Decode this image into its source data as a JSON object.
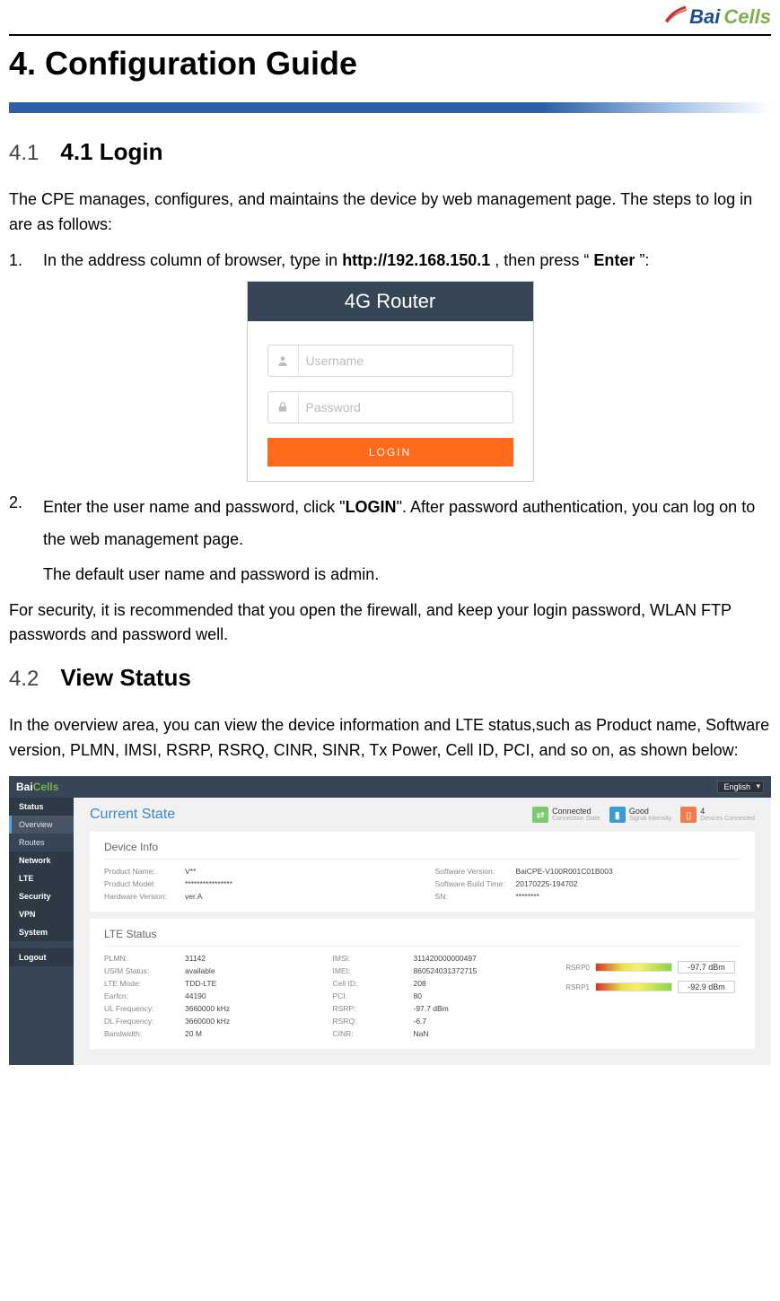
{
  "logo": {
    "part1": "Bai",
    "part2": "Cells"
  },
  "h1": "4. Configuration Guide",
  "sec41": {
    "num": "4.1",
    "title": "4.1 Login",
    "intro": "The CPE manages, configures, and maintains the device by web management page. The steps to log in are as follows:",
    "step1_num": "1.",
    "step1_pre": "In the address column of browser, type in ",
    "step1_bold1": "http://192.168.150.1",
    "step1_mid": ", then press “",
    "step1_bold2": "Enter",
    "step1_post": "”:",
    "step2_num": "2.",
    "step2_pre": "Enter the user name and password, click \"",
    "step2_bold": "LOGIN",
    "step2_post": "\". After password authentication, you can log on to the web management page.",
    "default_creds": "The default user name and password is admin.",
    "security_note": "For security, it is recommended that you open the firewall, and keep your login password, WLAN FTP passwords and password well."
  },
  "login_panel": {
    "banner": "4G Router",
    "username_ph": "Username",
    "password_ph": "Password",
    "login_btn": "LOGIN"
  },
  "sec42": {
    "num": "4.2",
    "title": "View Status",
    "body": "In the overview area, you can view the device information and LTE status,such as Product name, Software version, PLMN, IMSI, RSRP, RSRQ, CINR, SINR, Tx Power, Cell ID, PCI, and so on, as shown below:"
  },
  "shot": {
    "logo_b": "Bai",
    "logo_c": "Cells",
    "lang": "English",
    "side": {
      "status": "Status",
      "overview": "Overview",
      "routes": "Routes",
      "network": "Network",
      "lte": "LTE",
      "security": "Security",
      "vpn": "VPN",
      "system": "System",
      "logout": "Logout"
    },
    "title": "Current State",
    "badges": {
      "b1_top": "Connected",
      "b1_bot": "Connection State",
      "b2_top": "Good",
      "b2_bot": "Signal Intensity",
      "b3_top": "4",
      "b3_bot": "Devices Connected"
    },
    "device_info": {
      "heading": "Device Info",
      "rows": [
        {
          "k": "Product Name:",
          "v": "V**"
        },
        {
          "k": "Software Version:",
          "v": "BaiCPE-V100R001C01B003"
        },
        {
          "k": "Product Model:",
          "v": "****************"
        },
        {
          "k": "Software Build Time:",
          "v": "20170225-194702"
        },
        {
          "k": "Hardware Version:",
          "v": "ver.A"
        },
        {
          "k": "SN:",
          "v": "********"
        }
      ]
    },
    "lte": {
      "heading": "LTE Status",
      "rows": [
        {
          "k": "PLMN:",
          "v": "31142"
        },
        {
          "k": "IMSI:",
          "v": "311420000000497"
        },
        {
          "k": "USIM Status:",
          "v": "available"
        },
        {
          "k": "IMEI:",
          "v": "860524031372715"
        },
        {
          "k": "LTE Mode:",
          "v": "TDD-LTE"
        },
        {
          "k": "Cell ID:",
          "v": "208"
        },
        {
          "k": "Earfcn:",
          "v": "44190"
        },
        {
          "k": "PCI:",
          "v": "80"
        },
        {
          "k": "UL Frequency:",
          "v": "3660000 kHz"
        },
        {
          "k": "RSRP:",
          "v": "-97.7 dBm"
        },
        {
          "k": "DL Frequency:",
          "v": "3660000 kHz"
        },
        {
          "k": "RSRQ:",
          "v": "-6.7"
        },
        {
          "k": "Bandwidth:",
          "v": "20 M"
        },
        {
          "k": "CINR:",
          "v": "NaN"
        }
      ],
      "meters": {
        "m1_label": "RSRP0",
        "m1_val": "-97.7 dBm",
        "m2_label": "RSRP1",
        "m2_val": "-92.9 dBm"
      }
    }
  },
  "chart_data": {
    "type": "table",
    "title": "RSRP signal meters",
    "series": [
      {
        "name": "RSRP0",
        "values": [
          -97.7
        ],
        "unit": "dBm"
      },
      {
        "name": "RSRP1",
        "values": [
          -92.9
        ],
        "unit": "dBm"
      }
    ]
  }
}
